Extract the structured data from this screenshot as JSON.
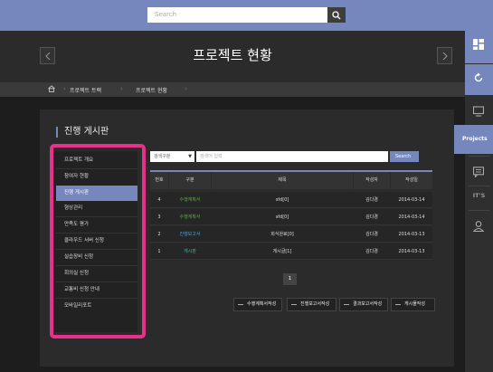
{
  "search": {
    "placeholder": "Search"
  },
  "header": {
    "title": "프로젝트 현황"
  },
  "breadcrumb": {
    "items": [
      "프로젝트 트랙",
      "프로젝트 현황"
    ]
  },
  "right_sidebar": {
    "projects_label": "Projects",
    "its_label": "IT'S"
  },
  "board": {
    "title": "진행 게시판"
  },
  "left_menu": {
    "items": [
      "프로젝트 개요",
      "참여자 현황",
      "진행 게시판",
      "형상관리",
      "만족도 평가",
      "클라우드 서버 신청",
      "실습장비 신청",
      "회의실 신청",
      "교통비 신청 안내",
      "모바일리포트"
    ],
    "active_index": 2
  },
  "filter": {
    "select_value": "검색구분",
    "keyword_placeholder": "검색어 입력",
    "search_button": "Search"
  },
  "table": {
    "headers": [
      "번호",
      "구분",
      "제목",
      "작성자",
      "작성일"
    ],
    "rows": [
      {
        "no": "4",
        "type": "수행계획서",
        "title": "sfd[0]",
        "author": "김다경",
        "date": "2014-03-14"
      },
      {
        "no": "3",
        "type": "수행계획서",
        "title": "sfd[0]",
        "author": "김다경",
        "date": "2014-03-14"
      },
      {
        "no": "2",
        "type": "진행보고서",
        "title": "회식완료[0]",
        "author": "김다경",
        "date": "2014-03-13"
      },
      {
        "no": "1",
        "type": "게시판",
        "title": "게시글[1]",
        "author": "김다경",
        "date": "2014-03-13"
      }
    ]
  },
  "pagination": {
    "current": "1"
  },
  "actions": {
    "btn1": "수행계획서작성",
    "btn2": "진행보고서작성",
    "btn3": "결과보고서작성",
    "btn4": "게시물작성"
  },
  "colors": {
    "accent": "#7587bd",
    "highlight": "#e7318a",
    "green": "#5ea84a",
    "blue": "#4f9fd9",
    "teal": "#3fb0b0"
  }
}
